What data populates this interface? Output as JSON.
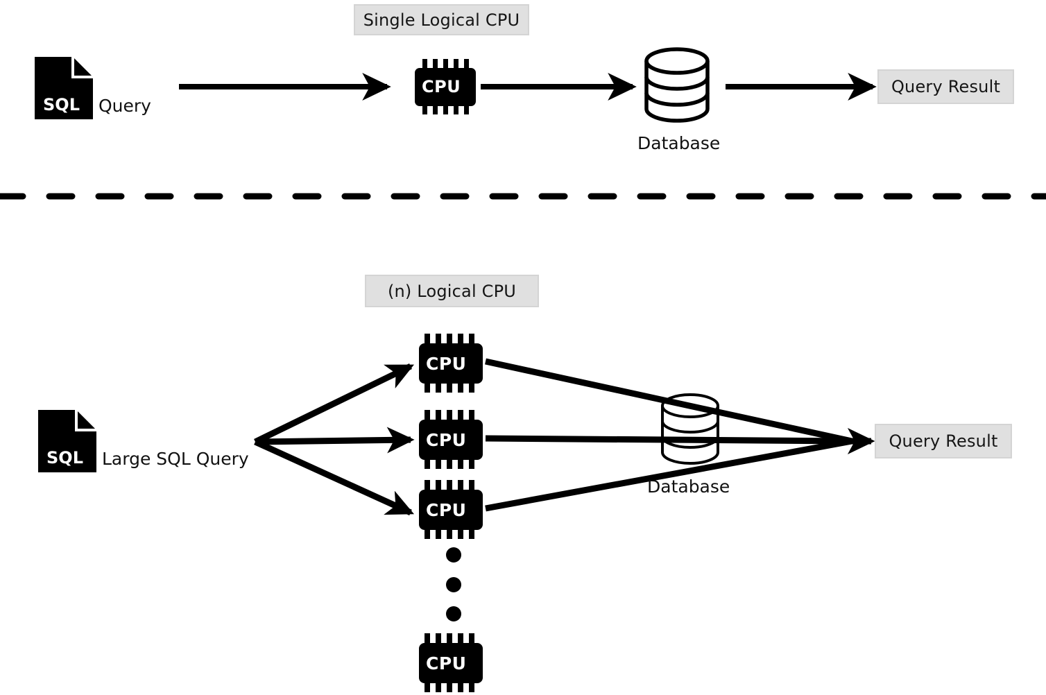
{
  "diagram": {
    "title_top": "Single Logical CPU",
    "title_bottom": "(n) Logical CPU",
    "top_section": {
      "source_icon_label": "SQL",
      "source_label": "Query",
      "cpu_label": "CPU",
      "database_label": "Database",
      "result_label": "Query Result",
      "arrows": [
        {
          "name": "query-to-cpu",
          "from": "sql-query",
          "to": "cpu"
        },
        {
          "name": "cpu-to-database",
          "from": "cpu",
          "to": "database"
        },
        {
          "name": "database-to-result",
          "from": "database",
          "to": "query-result"
        }
      ]
    },
    "bottom_section": {
      "source_icon_label": "SQL",
      "source_label": "Large SQL Query",
      "cpu_label": "CPU",
      "cpu_count_visible": 4,
      "ellipsis_dots": 3,
      "database_label": "Database",
      "result_label": "Query Result",
      "fanout_arrows": [
        {
          "name": "query-to-cpu-1",
          "from": "large-sql-query",
          "to": "cpu-1"
        },
        {
          "name": "query-to-cpu-2",
          "from": "large-sql-query",
          "to": "cpu-2"
        },
        {
          "name": "query-to-cpu-3",
          "from": "large-sql-query",
          "to": "cpu-3"
        }
      ],
      "fanin_arrows": [
        {
          "name": "cpu-1-to-result",
          "from": "cpu-1",
          "to": "query-result"
        },
        {
          "name": "cpu-2-to-result",
          "from": "cpu-2",
          "to": "query-result"
        },
        {
          "name": "cpu-3-to-result",
          "from": "cpu-3",
          "to": "query-result"
        }
      ]
    },
    "divider": {
      "style": "dashed",
      "dash_length": 33,
      "gap_length": 38,
      "thickness": 9
    },
    "colors": {
      "ink": "#000000",
      "label_box_fill": "#e0e0e0",
      "label_box_border": "#d4d4d4",
      "background": "#ffffff",
      "chip_text": "#ffffff"
    }
  }
}
